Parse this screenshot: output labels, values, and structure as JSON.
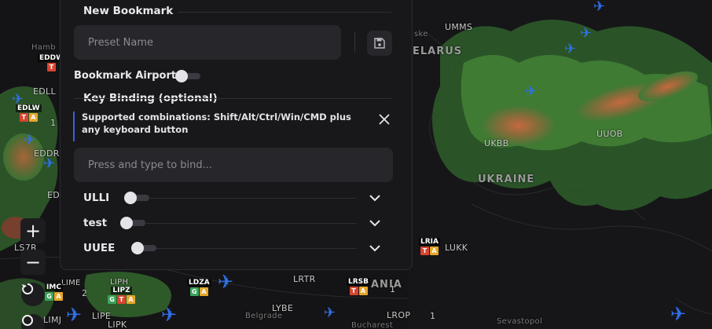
{
  "panel": {
    "title": "New Bookmark",
    "preset_placeholder": "Preset Name",
    "bookmark_airport_label": "Bookmark Airport",
    "bookmark_airport_on": false,
    "key_binding_title": "Key Binding (optional)",
    "info_text": "Supported combinations: Shift/Alt/Ctrl/Win/CMD plus any keyboard button",
    "bind_placeholder": "Press and type to bind...",
    "rows": [
      {
        "label": "ULLI",
        "toggle_on": false
      },
      {
        "label": "test",
        "toggle_on": false
      },
      {
        "label": "UUEE",
        "toggle_on": false
      }
    ]
  },
  "map_controls": {
    "zoom_in": "+",
    "zoom_out": "−"
  },
  "map": {
    "region_labels": [
      "UKRAINE",
      "ELARUS",
      "ANIA"
    ],
    "place_labels": [
      "Hamb",
      "Belgrade",
      "Bucharest",
      "Sevastopol",
      "ske"
    ],
    "airports": [
      {
        "code": "UMMS"
      },
      {
        "code": "UKBB"
      },
      {
        "code": "UUOB"
      },
      {
        "code": "LUKK"
      },
      {
        "code": "LRIA",
        "badges": [
          "T",
          "A"
        ]
      },
      {
        "code": "LRSB",
        "badges": [
          "T",
          "A"
        ],
        "count": "1"
      },
      {
        "code": "LRTR"
      },
      {
        "code": "LYBE"
      },
      {
        "code": "LROP",
        "count": "1"
      },
      {
        "code": "LDZA",
        "badges": [
          "G",
          "A"
        ]
      },
      {
        "code": "LIPZ",
        "badges": [
          "G",
          "T",
          "A"
        ]
      },
      {
        "code": "LIPH"
      },
      {
        "code": "LIPE"
      },
      {
        "code": "LIPK"
      },
      {
        "code": "LIMJ"
      },
      {
        "code": "LIME"
      },
      {
        "code": "IMC",
        "badges": [
          "G",
          "A"
        ],
        "count": "2"
      },
      {
        "code": "EDDW",
        "badges": [
          "T"
        ]
      },
      {
        "code": "EDLW",
        "badges": [
          "T",
          "A"
        ],
        "count": "1"
      },
      {
        "code": "EDLL"
      },
      {
        "code": "EDDR"
      },
      {
        "code": "ED"
      },
      {
        "code": "LS7R"
      }
    ]
  },
  "colors": {
    "panel_bg": "#18181b",
    "input_bg": "#26262b",
    "accent_blue": "#3d5fe0",
    "plane_blue": "#2f6fe8",
    "badge_T": "#d64531",
    "badge_A": "#e5a72b",
    "badge_G": "#3aa35a"
  }
}
